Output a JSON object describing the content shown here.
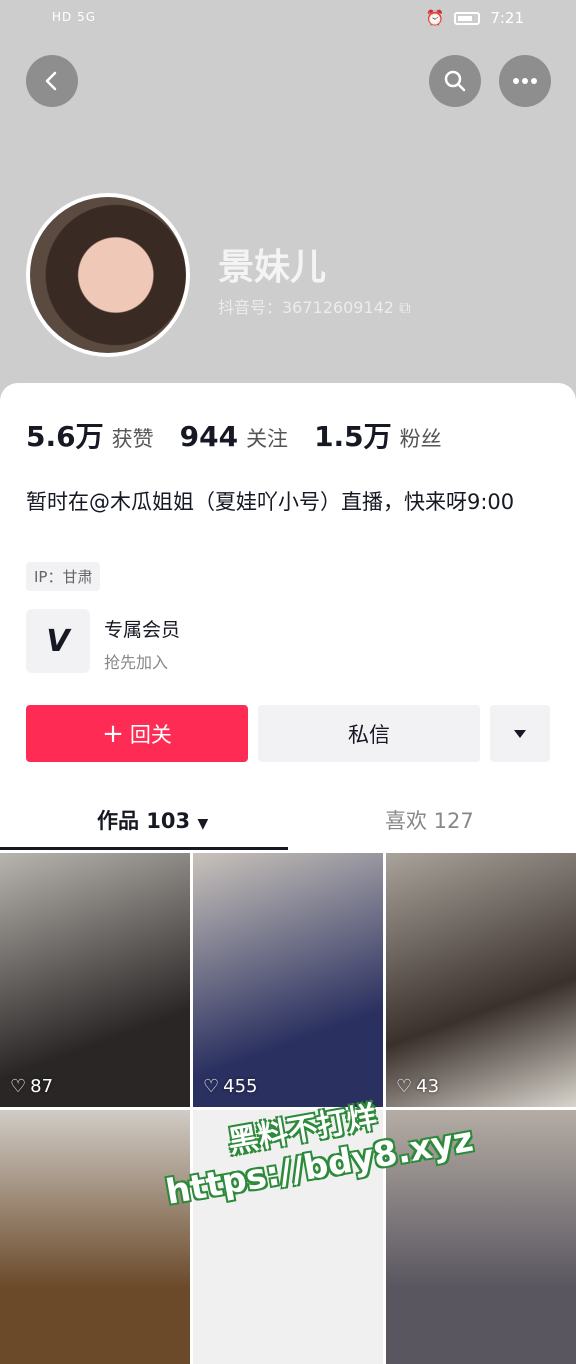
{
  "status_bar": {
    "signal_text": "HD 5G",
    "time": "7:21"
  },
  "header": {
    "back_icon": "back-arrow-icon",
    "search_icon": "search-icon",
    "more_icon": "more-dots-icon"
  },
  "profile": {
    "name": "景妹儿",
    "douyin_id": "抖音号：36712609142"
  },
  "stats": [
    {
      "num": "5.6万",
      "label": "获赞"
    },
    {
      "num": "944",
      "label": "关注"
    },
    {
      "num": "1.5万",
      "label": "粉丝"
    }
  ],
  "bio": "暂时在@木瓜姐姐（夏娃吖小号）直播，快来呀9:00",
  "ip_tag": "IP：甘肃",
  "vip": {
    "title": "专属会员",
    "subtitle": "抢先加入"
  },
  "buttons": {
    "follow": "回关",
    "message": "私信"
  },
  "tabs": {
    "works": "作品 103",
    "likes": "喜欢 127"
  },
  "videos": [
    {
      "likes": "87"
    },
    {
      "likes": "455"
    },
    {
      "likes": "43"
    },
    {
      "likes": ""
    },
    {
      "likes": ""
    },
    {
      "likes": ""
    }
  ],
  "watermark": {
    "line1": "黑料不打烊",
    "line2": "https://bdy8.xyz"
  },
  "colors": {
    "accent": "#fe2c55",
    "header_bg": "#cdcdcd"
  }
}
